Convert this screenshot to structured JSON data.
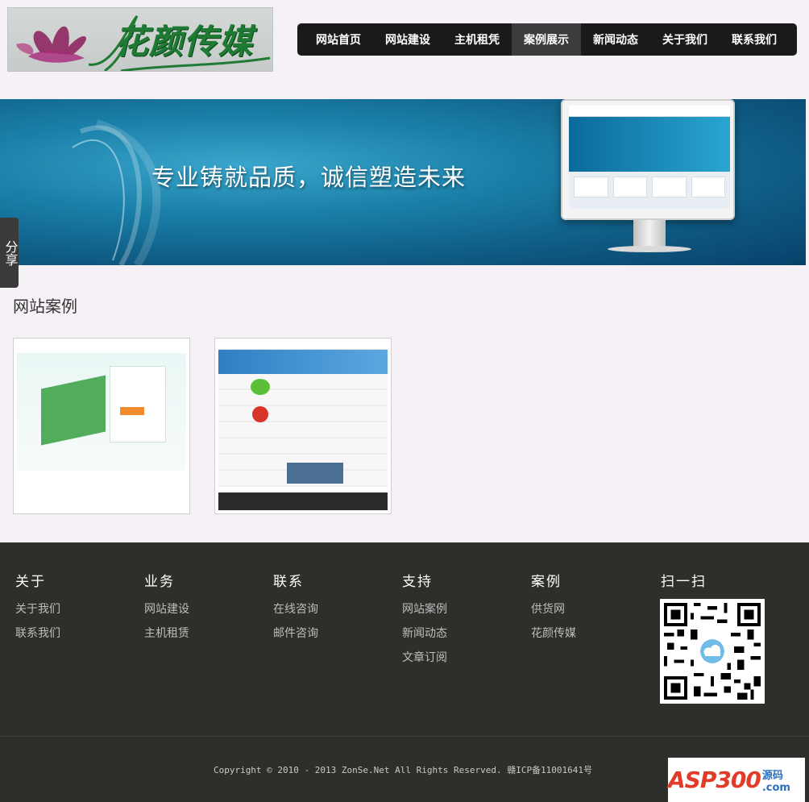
{
  "header": {
    "logo_text": "花颜传媒",
    "nav": [
      {
        "label": "网站首页"
      },
      {
        "label": "网站建设"
      },
      {
        "label": "主机租凭"
      },
      {
        "label": "案例展示",
        "active": true
      },
      {
        "label": "新闻动态"
      },
      {
        "label": "关于我们"
      },
      {
        "label": "联系我们"
      }
    ]
  },
  "banner": {
    "slogan": "专业铸就品质，诚信塑造未来"
  },
  "share": {
    "label": "分享"
  },
  "main": {
    "section_title": "网站案例",
    "cases": [
      {
        "name": "case-1"
      },
      {
        "name": "case-2"
      }
    ]
  },
  "footer": {
    "columns": [
      {
        "title": "关于",
        "links": [
          "关于我们",
          "联系我们"
        ]
      },
      {
        "title": "业务",
        "links": [
          "网站建设",
          "主机租赁"
        ]
      },
      {
        "title": "联系",
        "links": [
          "在线咨询",
          "邮件咨询"
        ]
      },
      {
        "title": "支持",
        "links": [
          "网站案例",
          "新闻动态",
          "文章订阅"
        ]
      },
      {
        "title": "案例",
        "links": [
          "供货网",
          "花颜传媒"
        ]
      }
    ],
    "qr_title": "扫一扫",
    "copyright": "Copyright © 2010 - 2013 ZonSe.Net All Rights Reserved. 赣ICP备11001641号",
    "watermark": {
      "text": "ASP300",
      "sub": "源码 .com"
    }
  },
  "colors": {
    "page_bg": "#f6f1f6",
    "nav_bg": "#1a1a1a",
    "nav_active": "#3c3c3c",
    "footer_bg": "#2e2e2b",
    "logo_green": "#1f7a33"
  }
}
